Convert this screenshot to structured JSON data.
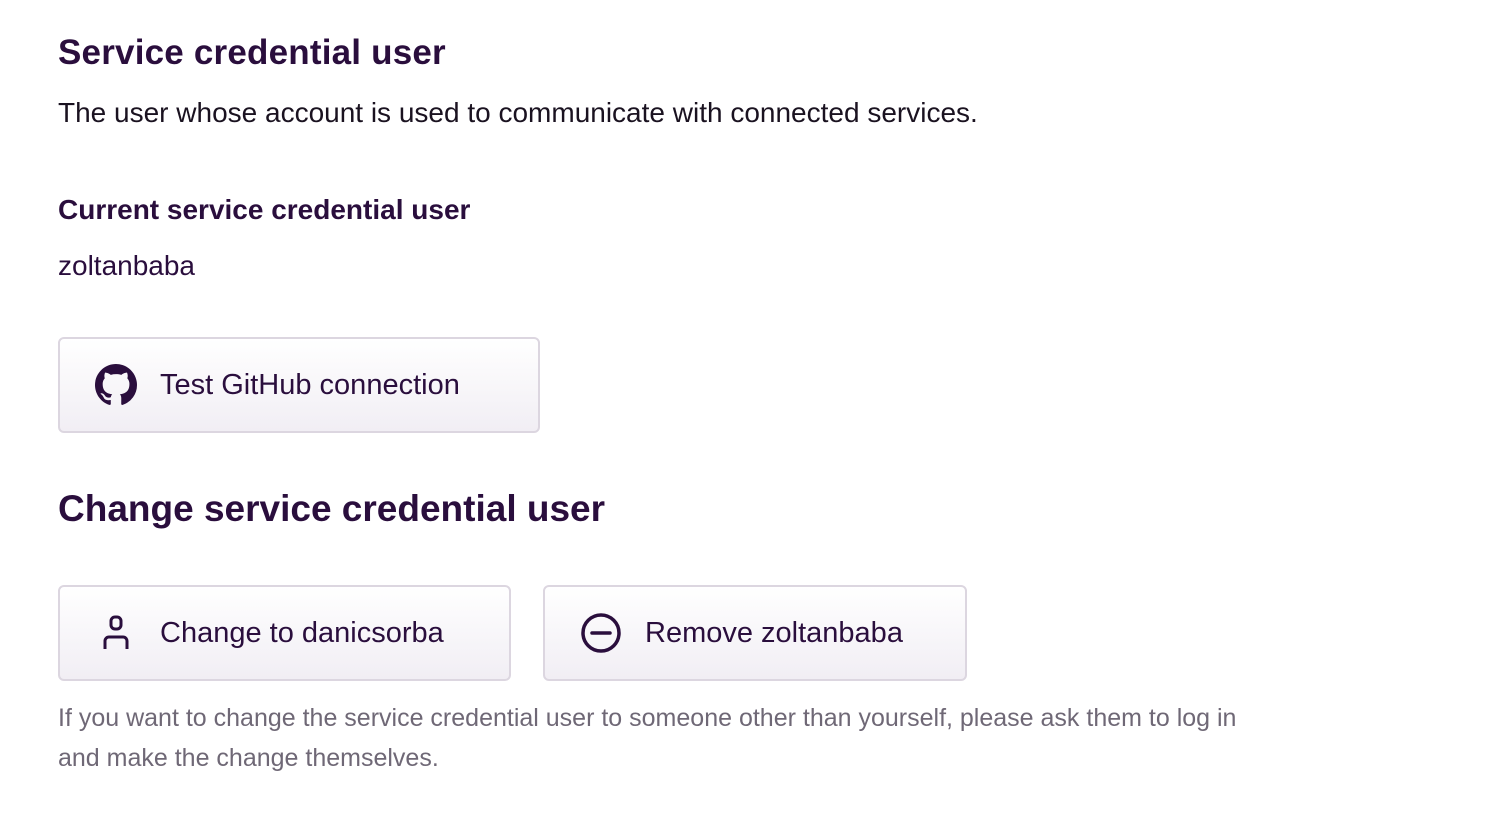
{
  "section": {
    "title": "Service credential user",
    "description": "The user whose account is used to communicate with connected services."
  },
  "current": {
    "label": "Current service credential user",
    "username": "zoltanbaba"
  },
  "buttons": {
    "test_label": "Test GitHub connection",
    "test_icon": "github-icon",
    "change_label": "Change to danicsorba",
    "change_icon": "user-icon",
    "remove_label": "Remove zoltanbaba",
    "remove_icon": "minus-circle-icon"
  },
  "change_section": {
    "title": "Change service credential user",
    "note": "If you want to change the service credential user to someone other than yourself, please ask them to log in and make the change themselves."
  },
  "colors": {
    "text": "#2a0e3d",
    "muted": "#6f6876",
    "button_border": "#dcd6e0"
  }
}
